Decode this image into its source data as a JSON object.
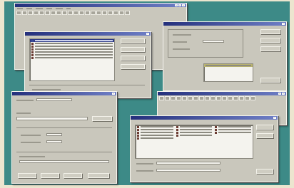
{
  "colors": {
    "desktop": "#3d8a87",
    "window_face": "#c9c7bc",
    "title_bar_start": "#24307c",
    "title_bar_end": "#6f7fc6",
    "selection": "#2e3a86"
  },
  "windows": [
    {
      "id": "main_app",
      "title_bar_icon": "app-icon"
    },
    {
      "id": "properties_dialog",
      "title_bar_icon": "window-icon"
    },
    {
      "id": "options_dialog",
      "title_bar_icon": "window-icon"
    },
    {
      "id": "record_dialog",
      "title_bar_icon": "window-icon"
    },
    {
      "id": "browser_dialog",
      "title_bar_icon": "window-icon"
    },
    {
      "id": "picker_dialog",
      "title_bar_icon": "window-icon"
    }
  ],
  "icons": [
    "app-icon",
    "window-icon",
    "minimize-icon",
    "maximize-icon",
    "close-icon",
    "toolbar-icon",
    "list-item-icon",
    "folder-icon"
  ]
}
